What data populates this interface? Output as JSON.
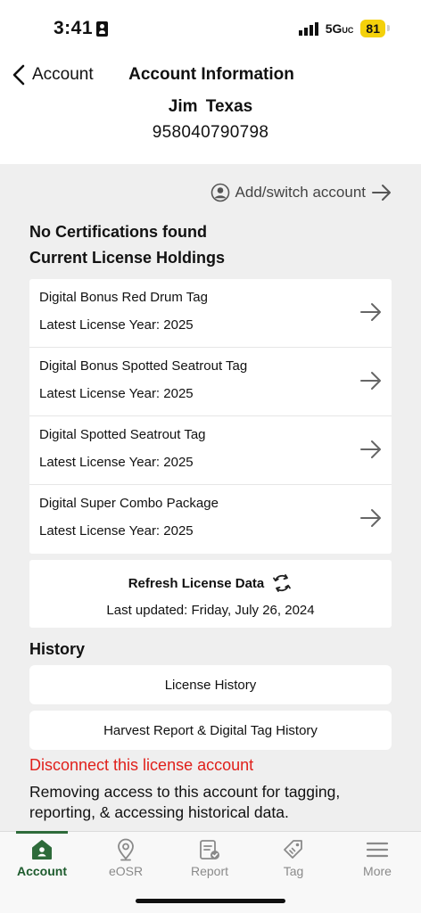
{
  "status": {
    "time": "3:41",
    "network": "5G",
    "network_sup": "UC",
    "battery": "81"
  },
  "header": {
    "back_label": "Account",
    "title": "Account Information",
    "user_name": "Jim  Texas",
    "user_number": "958040790798"
  },
  "account": {
    "add_switch_label": "Add/switch account",
    "no_certifications": "No Certifications found",
    "holdings_heading": "Current License Holdings"
  },
  "licenses": [
    {
      "name": "Digital Bonus Red Drum Tag",
      "year": "Latest License Year: 2025"
    },
    {
      "name": "Digital Bonus Spotted Seatrout Tag",
      "year": "Latest License Year: 2025"
    },
    {
      "name": "Digital Spotted Seatrout Tag",
      "year": "Latest License Year: 2025"
    },
    {
      "name": "Digital Super Combo Package",
      "year": "Latest License Year: 2025"
    }
  ],
  "refresh": {
    "label": "Refresh License Data",
    "last_updated": "Last updated: Friday, July 26, 2024"
  },
  "history": {
    "heading": "History",
    "license_history": "License History",
    "harvest_history": "Harvest Report & Digital Tag History"
  },
  "disconnect": {
    "link": "Disconnect this license account",
    "description": "Removing access to this account for tagging, reporting, & accessing historical data."
  },
  "tabs": [
    {
      "label": "Account",
      "icon": "home-icon",
      "active": true
    },
    {
      "label": "eOSR",
      "icon": "location-pin-icon",
      "active": false
    },
    {
      "label": "Report",
      "icon": "report-icon",
      "active": false
    },
    {
      "label": "Tag",
      "icon": "tag-icon",
      "active": false
    },
    {
      "label": "More",
      "icon": "menu-icon",
      "active": false
    }
  ],
  "colors": {
    "accent": "#2e6b3a",
    "danger": "#e0201b",
    "battery": "#f4d10b",
    "background": "#efefef"
  }
}
